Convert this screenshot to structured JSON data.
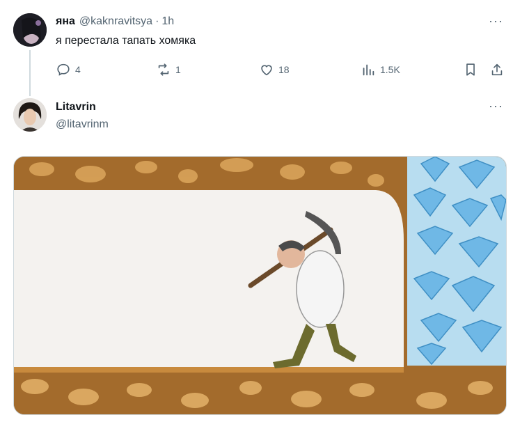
{
  "parent_tweet": {
    "display_name": "яна",
    "handle": "@kaknravitsya",
    "separator": "·",
    "time": "1h",
    "text": "я перестала тапать хомяка",
    "more_label": "···",
    "actions": {
      "reply_count": "4",
      "retweet_count": "1",
      "like_count": "18",
      "views_count": "1.5K"
    }
  },
  "reply_tweet": {
    "display_name": "Litavrin",
    "handle": "@litavrinm",
    "more_label": "···"
  },
  "colors": {
    "text_primary": "#0f1419",
    "text_secondary": "#536471",
    "thread_line": "#cfd9de",
    "dirt": "#a0692a",
    "diamond": "#6fb8e6"
  },
  "icons": [
    "reply-icon",
    "retweet-icon",
    "like-icon",
    "views-icon",
    "bookmark-icon",
    "share-icon"
  ]
}
